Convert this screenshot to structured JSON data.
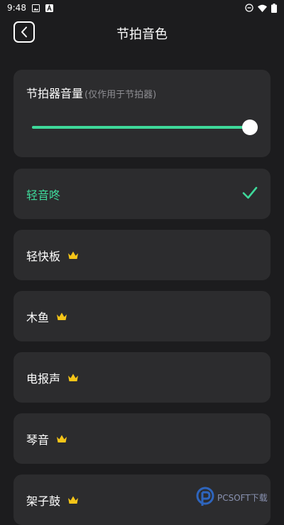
{
  "status_bar": {
    "time": "9:48"
  },
  "header": {
    "title": "节拍音色"
  },
  "volume": {
    "title": "节拍器音量",
    "note": "(仅作用于节拍器)",
    "level_percent": 100
  },
  "sounds": [
    {
      "label": "轻音咚",
      "selected": true,
      "premium": false
    },
    {
      "label": "轻快板",
      "selected": false,
      "premium": true
    },
    {
      "label": "木鱼",
      "selected": false,
      "premium": true
    },
    {
      "label": "电报声",
      "selected": false,
      "premium": true
    },
    {
      "label": "琴音",
      "selected": false,
      "premium": true
    },
    {
      "label": "架子鼓",
      "selected": false,
      "premium": true
    }
  ],
  "colors": {
    "accent": "#3ed99a",
    "crown": "#f5c518",
    "card": "#2c2c2e",
    "background": "#1c1c1e"
  },
  "watermark": {
    "text": "PCSOFT下载"
  }
}
